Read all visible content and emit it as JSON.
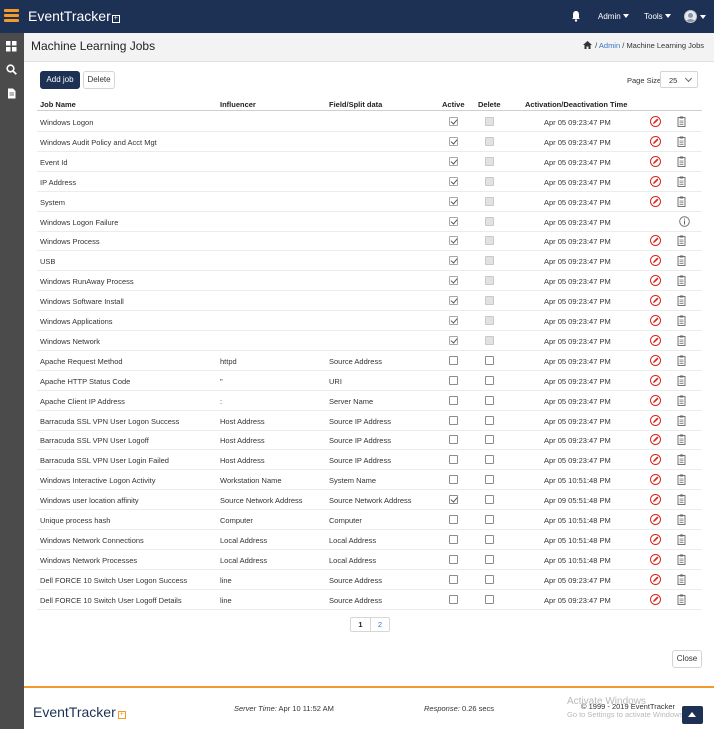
{
  "app": {
    "name": "EventTracker",
    "plus": "+"
  },
  "topnav": {
    "admin": "Admin",
    "tools": "Tools"
  },
  "page": {
    "title": "Machine Learning Jobs"
  },
  "breadcrumb": {
    "admin": "Admin",
    "sep1": "/",
    "sep2": "/",
    "current": "Machine Learning Jobs"
  },
  "toolbar": {
    "add_job": "Add job",
    "delete": "Delete",
    "page_size_label": "Page Size",
    "page_size_value": "25"
  },
  "table": {
    "headers": {
      "job_name": "Job Name",
      "influencer": "Influencer",
      "field": "Field/Split data",
      "active": "Active",
      "delete": "Delete",
      "time": "Activation/Deactivation Time"
    },
    "rows": [
      {
        "name": "Windows Logon",
        "influencer": "",
        "field": "",
        "active": true,
        "active_disabled": true,
        "delete": false,
        "delete_disabled": true,
        "time": "Apr 05 09:23:47 PM",
        "action": "edit"
      },
      {
        "name": "Windows Audit Policy and Acct Mgt",
        "influencer": "",
        "field": "",
        "active": true,
        "active_disabled": true,
        "delete": false,
        "delete_disabled": true,
        "time": "Apr 05 09:23:47 PM",
        "action": "edit"
      },
      {
        "name": "Event Id",
        "influencer": "",
        "field": "",
        "active": true,
        "active_disabled": true,
        "delete": false,
        "delete_disabled": true,
        "time": "Apr 05 09:23:47 PM",
        "action": "edit"
      },
      {
        "name": "IP Address",
        "influencer": "",
        "field": "",
        "active": true,
        "active_disabled": true,
        "delete": false,
        "delete_disabled": true,
        "time": "Apr 05 09:23:47 PM",
        "action": "edit"
      },
      {
        "name": "System",
        "influencer": "",
        "field": "",
        "active": true,
        "active_disabled": true,
        "delete": false,
        "delete_disabled": true,
        "time": "Apr 05 09:23:47 PM",
        "action": "edit"
      },
      {
        "name": "Windows Logon Failure",
        "influencer": "",
        "field": "",
        "active": true,
        "active_disabled": true,
        "delete": false,
        "delete_disabled": true,
        "time": "Apr 05 09:23:47 PM",
        "action": "info"
      },
      {
        "name": "Windows Process",
        "influencer": "",
        "field": "",
        "active": true,
        "active_disabled": true,
        "delete": false,
        "delete_disabled": true,
        "time": "Apr 05 09:23:47 PM",
        "action": "edit"
      },
      {
        "name": "USB",
        "influencer": "",
        "field": "",
        "active": true,
        "active_disabled": true,
        "delete": false,
        "delete_disabled": true,
        "time": "Apr 05 09:23:47 PM",
        "action": "edit"
      },
      {
        "name": "Windows RunAway Process",
        "influencer": "",
        "field": "",
        "active": true,
        "active_disabled": true,
        "delete": false,
        "delete_disabled": true,
        "time": "Apr 05 09:23:47 PM",
        "action": "edit"
      },
      {
        "name": "Windows Software Install",
        "influencer": "",
        "field": "",
        "active": true,
        "active_disabled": true,
        "delete": false,
        "delete_disabled": true,
        "time": "Apr 05 09:23:47 PM",
        "action": "edit"
      },
      {
        "name": "Windows Applications",
        "influencer": "",
        "field": "",
        "active": true,
        "active_disabled": true,
        "delete": false,
        "delete_disabled": true,
        "time": "Apr 05 09:23:47 PM",
        "action": "edit"
      },
      {
        "name": "Windows Network",
        "influencer": "",
        "field": "",
        "active": true,
        "active_disabled": true,
        "delete": false,
        "delete_disabled": true,
        "time": "Apr 05 09:23:47 PM",
        "action": "edit"
      },
      {
        "name": "Apache Request Method",
        "influencer": "httpd",
        "field": "Source Address",
        "active": false,
        "active_disabled": false,
        "delete": false,
        "delete_disabled": false,
        "time": "Apr 05 09:23:47 PM",
        "action": "edit"
      },
      {
        "name": "Apache HTTP Status Code",
        "influencer": "\"",
        "field": "URI",
        "active": false,
        "active_disabled": false,
        "delete": false,
        "delete_disabled": false,
        "time": "Apr 05 09:23:47 PM",
        "action": "edit"
      },
      {
        "name": "Apache Client IP Address",
        "influencer": ":",
        "field": "Server Name",
        "active": false,
        "active_disabled": false,
        "delete": false,
        "delete_disabled": false,
        "time": "Apr 05 09:23:47 PM",
        "action": "edit"
      },
      {
        "name": "Barracuda SSL VPN User Logon Success",
        "influencer": "Host Address",
        "field": "Source IP Address",
        "active": false,
        "active_disabled": false,
        "delete": false,
        "delete_disabled": false,
        "time": "Apr 05 09:23:47 PM",
        "action": "edit"
      },
      {
        "name": "Barracuda SSL VPN User Logoff",
        "influencer": "Host Address",
        "field": "Source IP Address",
        "active": false,
        "active_disabled": false,
        "delete": false,
        "delete_disabled": false,
        "time": "Apr 05 09:23:47 PM",
        "action": "edit"
      },
      {
        "name": "Barracuda SSL VPN User Login Failed",
        "influencer": "Host Address",
        "field": "Source IP Address",
        "active": false,
        "active_disabled": false,
        "delete": false,
        "delete_disabled": false,
        "time": "Apr 05 09:23:47 PM",
        "action": "edit"
      },
      {
        "name": "Windows Interactive Logon Activity",
        "influencer": "Workstation Name",
        "field": "System Name",
        "active": false,
        "active_disabled": false,
        "delete": false,
        "delete_disabled": false,
        "time": "Apr 05 10:51:48 PM",
        "action": "edit"
      },
      {
        "name": "Windows user location affinity",
        "influencer": "Source Network Address",
        "field": "Source Network Address",
        "active": true,
        "active_disabled": false,
        "delete": false,
        "delete_disabled": false,
        "time": "Apr 09 05:51:48 PM",
        "action": "edit"
      },
      {
        "name": "Unique process hash",
        "influencer": "Computer",
        "field": "Computer",
        "active": false,
        "active_disabled": false,
        "delete": false,
        "delete_disabled": false,
        "time": "Apr 05 10:51:48 PM",
        "action": "edit"
      },
      {
        "name": "Windows Network Connections",
        "influencer": "Local Address",
        "field": "Local Address",
        "active": false,
        "active_disabled": false,
        "delete": false,
        "delete_disabled": false,
        "time": "Apr 05 10:51:48 PM",
        "action": "edit"
      },
      {
        "name": "Windows Network Processes",
        "influencer": "Local Address",
        "field": "Local Address",
        "active": false,
        "active_disabled": false,
        "delete": false,
        "delete_disabled": false,
        "time": "Apr 05 10:51:48 PM",
        "action": "edit"
      },
      {
        "name": "Dell FORCE 10 Switch User Logon Success",
        "influencer": "line",
        "field": "Source Address",
        "active": false,
        "active_disabled": false,
        "delete": false,
        "delete_disabled": false,
        "time": "Apr 05 09:23:47 PM",
        "action": "edit"
      },
      {
        "name": "Dell FORCE 10 Switch User Logoff Details",
        "influencer": "line",
        "field": "Source Address",
        "active": false,
        "active_disabled": false,
        "delete": false,
        "delete_disabled": false,
        "time": "Apr 05 09:23:47 PM",
        "action": "edit"
      }
    ]
  },
  "pagination": {
    "pages": [
      "1",
      "2"
    ],
    "current": "1"
  },
  "close_label": "Close",
  "footer": {
    "brand": "EventTracker",
    "server_time_label": "Server Time:",
    "server_time_value": "Apr 10 11:52 AM",
    "response_label": "Response:",
    "response_value": "0.26 secs",
    "copyright": "© 1999 - 2019 EventTracker",
    "watermark_title": "Activate Windows",
    "watermark_sub": "Go to Settings to activate Windows."
  },
  "colors": {
    "navy": "#1d3154",
    "orange": "#f39a2b",
    "edit_red": "#d9261c",
    "link": "#3a77c5"
  },
  "icons": {
    "menu": "hamburger-icon",
    "bell": "bell-icon",
    "home": "home-icon",
    "edit": "edit-icon",
    "delete": "clipboard-icon",
    "info": "info-icon"
  }
}
